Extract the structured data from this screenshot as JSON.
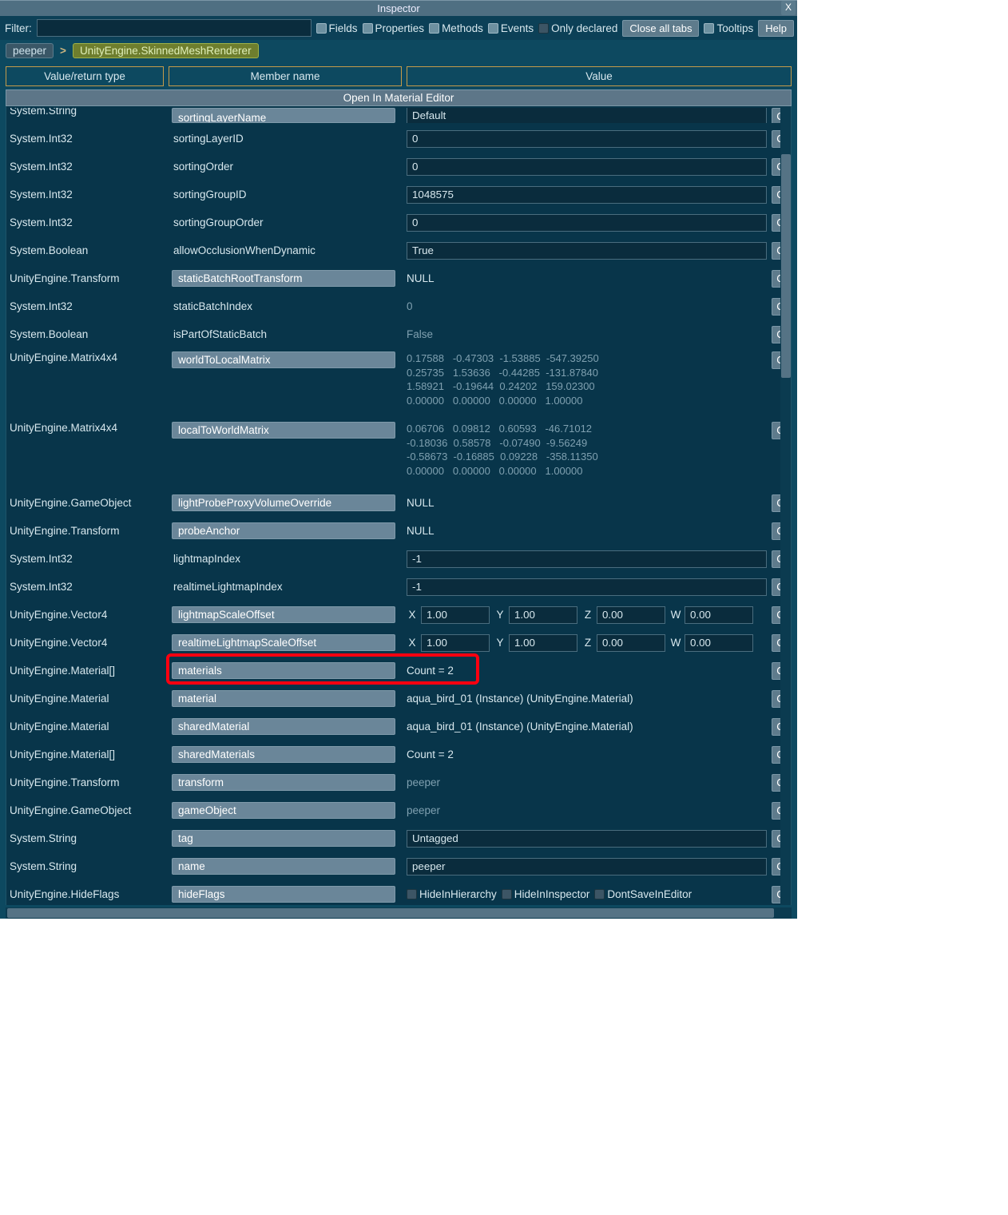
{
  "window": {
    "title": "Inspector"
  },
  "toolbar": {
    "filter_label": "Filter:",
    "toggles": {
      "fields": "Fields",
      "properties": "Properties",
      "methods": "Methods",
      "events": "Events",
      "only_declared": "Only declared",
      "tooltips": "Tooltips"
    },
    "close_tabs": "Close all tabs",
    "help": "Help"
  },
  "breadcrumb": {
    "root": "peeper",
    "sep": ">",
    "current": "UnityEngine.SkinnedMeshRenderer"
  },
  "headers": {
    "type": "Value/return type",
    "member": "Member name",
    "value": "Value"
  },
  "open_editor": "Open In Material Editor",
  "c_label": "C",
  "vec_labels": {
    "x": "X",
    "y": "Y",
    "z": "Z",
    "w": "W"
  },
  "rows": [
    {
      "kind": "cut",
      "type": "System.String",
      "memberBtn": "sortingLayerName",
      "valueInput": "Default"
    },
    {
      "kind": "input",
      "type": "System.Int32",
      "memberPlain": "sortingLayerID",
      "valueInput": "0"
    },
    {
      "kind": "input",
      "type": "System.Int32",
      "memberPlain": "sortingOrder",
      "valueInput": "0"
    },
    {
      "kind": "input",
      "type": "System.Int32",
      "memberPlain": "sortingGroupID",
      "valueInput": "1048575"
    },
    {
      "kind": "input",
      "type": "System.Int32",
      "memberPlain": "sortingGroupOrder",
      "valueInput": "0"
    },
    {
      "kind": "input",
      "type": "System.Boolean",
      "memberPlain": "allowOcclusionWhenDynamic",
      "valueInput": "True"
    },
    {
      "kind": "static",
      "type": "UnityEngine.Transform",
      "memberBtn": "staticBatchRootTransform",
      "valueStatic": "NULL"
    },
    {
      "kind": "dim",
      "type": "System.Int32",
      "memberPlain": "staticBatchIndex",
      "valueDim": "0"
    },
    {
      "kind": "dim",
      "type": "System.Boolean",
      "memberPlain": "isPartOfStaticBatch",
      "valueDim": "False"
    },
    {
      "kind": "matrix",
      "type": "UnityEngine.Matrix4x4",
      "memberBtn": "worldToLocalMatrix",
      "matrix": "0.17588   -0.47303  -1.53885  -547.39250\n0.25735   1.53636   -0.44285  -131.87840\n1.58921   -0.19644  0.24202   159.02300\n0.00000   0.00000   0.00000   1.00000"
    },
    {
      "kind": "matrix",
      "type": "UnityEngine.Matrix4x4",
      "memberBtn": "localToWorldMatrix",
      "matrix": "0.06706   0.09812   0.60593   -46.71012\n-0.18036  0.58578   -0.07490  -9.56249\n-0.58673  -0.16885  0.09228   -358.11350\n0.00000   0.00000   0.00000   1.00000"
    },
    {
      "kind": "static",
      "type": "UnityEngine.GameObject",
      "memberBtn": "lightProbeProxyVolumeOverride",
      "valueStatic": "NULL"
    },
    {
      "kind": "static",
      "type": "UnityEngine.Transform",
      "memberBtn": "probeAnchor",
      "valueStatic": "NULL"
    },
    {
      "kind": "input",
      "type": "System.Int32",
      "memberPlain": "lightmapIndex",
      "valueInput": "-1"
    },
    {
      "kind": "input",
      "type": "System.Int32",
      "memberPlain": "realtimeLightmapIndex",
      "valueInput": "-1"
    },
    {
      "kind": "vec4",
      "type": "UnityEngine.Vector4",
      "memberBtn": "lightmapScaleOffset",
      "vec": {
        "x": "1.00",
        "y": "1.00",
        "z": "0.00",
        "w": "0.00"
      }
    },
    {
      "kind": "vec4",
      "type": "UnityEngine.Vector4",
      "memberBtn": "realtimeLightmapScaleOffset",
      "vec": {
        "x": "1.00",
        "y": "1.00",
        "z": "0.00",
        "w": "0.00"
      }
    },
    {
      "kind": "static",
      "type": "UnityEngine.Material[]",
      "memberBtn": "materials",
      "valueStatic": "Count = 2",
      "highlight": true
    },
    {
      "kind": "static",
      "type": "UnityEngine.Material",
      "memberBtn": "material",
      "valueStatic": "aqua_bird_01 (Instance) (UnityEngine.Material)"
    },
    {
      "kind": "static",
      "type": "UnityEngine.Material",
      "memberBtn": "sharedMaterial",
      "valueStatic": "aqua_bird_01 (Instance) (UnityEngine.Material)"
    },
    {
      "kind": "static",
      "type": "UnityEngine.Material[]",
      "memberBtn": "sharedMaterials",
      "valueStatic": "Count = 2"
    },
    {
      "kind": "dim",
      "type": "UnityEngine.Transform",
      "memberBtn": "transform",
      "valueDim": "peeper"
    },
    {
      "kind": "dim",
      "type": "UnityEngine.GameObject",
      "memberBtn": "gameObject",
      "valueDim": "peeper"
    },
    {
      "kind": "input",
      "type": "System.String",
      "memberBtn": "tag",
      "valueInput": "Untagged"
    },
    {
      "kind": "input",
      "type": "System.String",
      "memberBtn": "name",
      "valueInput": "peeper"
    },
    {
      "kind": "flags",
      "type": "UnityEngine.HideFlags",
      "memberBtn": "hideFlags",
      "flags": [
        "HideInHierarchy",
        "HideInInspector",
        "DontSaveInEditor"
      ]
    }
  ]
}
